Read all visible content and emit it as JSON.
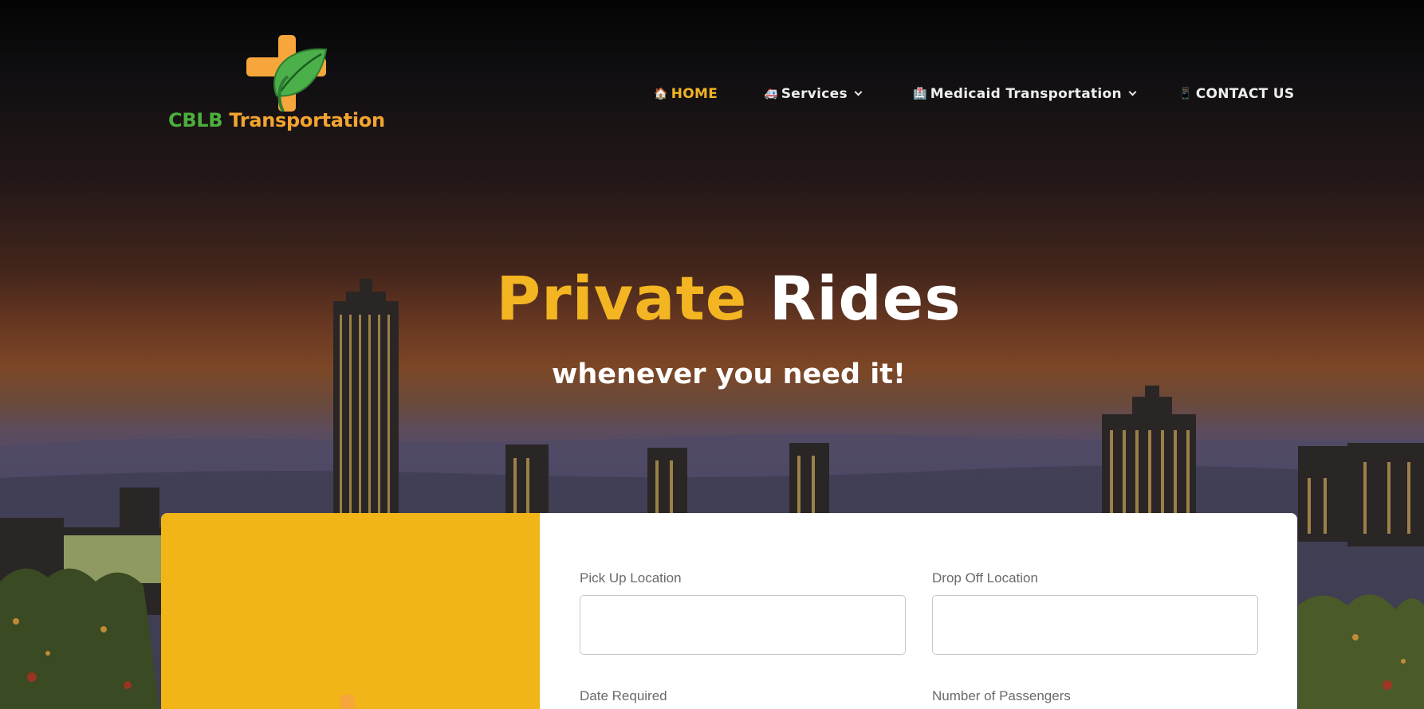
{
  "brand": {
    "name_part1": "CBLB",
    "name_part2": "Transportation",
    "colors": {
      "green": "#4caf3c",
      "orange": "#f3a430"
    }
  },
  "nav": {
    "home": {
      "icon": "🏠",
      "label": "HOME"
    },
    "services": {
      "icon": "🚑",
      "label": "Services"
    },
    "medicaid": {
      "icon": "🏥",
      "label": "Medicaid Transportation"
    },
    "contact": {
      "icon": "📱",
      "label": "CONTACT US"
    },
    "active_color": "#f1b424"
  },
  "hero": {
    "title_highlight": "Private",
    "title_rest": "Rides",
    "subtitle": "whenever you need it!",
    "accent_color": "#f3b521"
  },
  "form": {
    "pickup": {
      "label": "Pick Up Location",
      "value": ""
    },
    "dropoff": {
      "label": "Drop Off Location",
      "value": ""
    },
    "date": {
      "label": "Date Required"
    },
    "passengers": {
      "label": "Number of Passengers"
    },
    "panel_color": "#f1b517"
  }
}
